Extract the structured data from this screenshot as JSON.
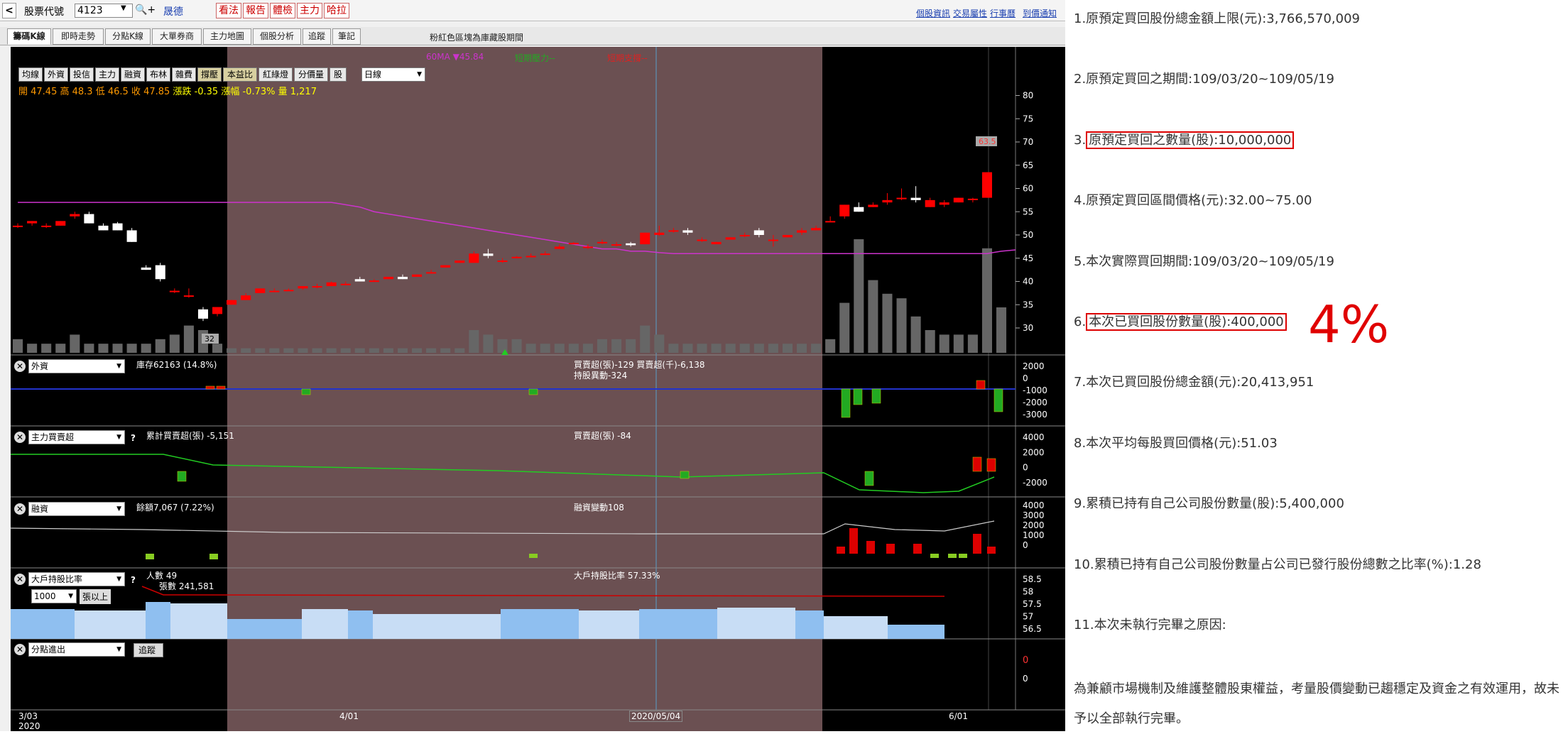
{
  "toolbar": {
    "back": "<",
    "stock_label": "股票代號",
    "stock_code": "4123",
    "search_plus": "🔍+",
    "company": "晟德",
    "buttons": [
      "看法",
      "報告",
      "體檢",
      "主力",
      "哈拉"
    ],
    "links": [
      "個股資訊",
      "交易屬性",
      "行事曆",
      "到價通知"
    ]
  },
  "tabs": [
    "籌碼K線",
    "即時走勢",
    "分點K線",
    "大單券商",
    "主力地圖",
    "個股分析",
    "追蹤",
    "筆記"
  ],
  "note": "粉紅色區塊為庫藏股期間",
  "legend": {
    "ma": "60MA ▼45.84",
    "short_power": "短期壓力--",
    "short_support": "短期支撐--"
  },
  "indicator_buttons": [
    "均線",
    "外資",
    "投信",
    "主力",
    "融資",
    "布林",
    "雜費",
    "撐壓",
    "本益比",
    "紅綠燈",
    "分價量",
    "股"
  ],
  "period": "日線",
  "ohlc": {
    "open": "開 47.45",
    "high": "高 48.3",
    "low": "低 46.5",
    "close": "收 47.85",
    "change": "漲跌 -0.35",
    "pct": "漲幅 -0.73%",
    "vol": "量 1,217"
  },
  "price_axis": [
    "80",
    "75",
    "70",
    "65",
    "60",
    "55",
    "50",
    "45",
    "40",
    "35",
    "30"
  ],
  "markers": {
    "low": "32",
    "high": "63.5"
  },
  "panels": {
    "foreign": {
      "select": "外資",
      "inventory": "庫存62163 (14.8%)",
      "buysell": "買賣超(張)-129 買賣超(千)-6,138",
      "change": "持股異動-324",
      "axis": [
        "2000",
        "0",
        "-1000",
        "-2000",
        "-3000"
      ]
    },
    "main": {
      "select": "主力買賣超",
      "q": "?",
      "cum": "累計買賣超(張) -5,151",
      "buysell": "買賣超(張) -84",
      "axis": [
        "4000",
        "2000",
        "0",
        "-2000"
      ]
    },
    "margin": {
      "select": "融資",
      "balance": "餘額7,067 (7.22%)",
      "change": "融資變動108",
      "axis": [
        "4000",
        "3000",
        "2000",
        "1000",
        "0"
      ]
    },
    "holders": {
      "select": "大戶持股比率",
      "q": "?",
      "people": "人數 49",
      "shares": "張數 241,581",
      "sub_select": "1000",
      "sub_label": "張以上",
      "ratio": "大戶持股比率 57.33%",
      "axis": [
        "58.5",
        "58",
        "57.5",
        "57",
        "56.5"
      ]
    },
    "branch": {
      "select": "分點進出",
      "track": "追蹤",
      "axis": [
        "0",
        "0"
      ]
    }
  },
  "dates": {
    "d1": "3/03",
    "y1": "2020",
    "d2": "4/01",
    "cursor": "2020/05/04",
    "d3": "6/01"
  },
  "chart_data": {
    "type": "candlestick",
    "candles": [
      [
        52,
        52.5,
        51.5,
        52
      ],
      [
        52.5,
        53,
        52,
        53
      ],
      [
        52,
        52.5,
        51.5,
        52
      ],
      [
        52,
        53,
        52,
        53
      ],
      [
        54,
        55,
        53.5,
        54.5
      ],
      [
        54.5,
        55,
        52.5,
        52.5
      ],
      [
        52,
        52.5,
        51,
        51
      ],
      [
        52.5,
        52.8,
        51,
        51
      ],
      [
        51,
        51.5,
        48.5,
        48.5
      ],
      [
        43,
        43.5,
        42.5,
        42.5
      ],
      [
        43.5,
        44,
        40,
        40.5
      ],
      [
        38,
        38.5,
        37.5,
        38
      ],
      [
        37,
        38.5,
        36.5,
        37
      ],
      [
        34,
        34.5,
        31.5,
        32
      ],
      [
        33,
        34.5,
        32.5,
        34.5
      ],
      [
        35,
        36,
        35,
        36
      ],
      [
        36,
        37.5,
        36,
        37
      ],
      [
        37.5,
        38.5,
        37.5,
        38.5
      ],
      [
        38,
        38.5,
        38,
        38
      ],
      [
        38,
        38.5,
        38,
        38.2
      ],
      [
        38.5,
        39,
        38.2,
        39
      ],
      [
        39,
        39.5,
        38.5,
        39
      ],
      [
        39,
        40,
        39,
        39.8
      ],
      [
        39.5,
        40,
        39.5,
        39.5
      ],
      [
        40.5,
        41,
        40,
        40
      ],
      [
        40,
        40.5,
        40,
        40.2
      ],
      [
        40.5,
        41,
        40.5,
        41
      ],
      [
        41,
        41.5,
        40.5,
        40.5
      ],
      [
        41,
        41.5,
        41,
        41.5
      ],
      [
        42,
        42.5,
        42,
        42
      ],
      [
        43,
        43.5,
        43,
        43.5
      ],
      [
        44,
        44.5,
        44,
        44.5
      ],
      [
        44,
        46.5,
        44,
        46
      ],
      [
        46,
        47,
        45,
        45.5
      ],
      [
        44.5,
        45,
        44,
        44.5
      ],
      [
        45,
        45.5,
        45,
        45.3
      ],
      [
        45.5,
        46,
        45.5,
        45.5
      ],
      [
        46,
        46.5,
        46,
        46
      ],
      [
        47,
        48,
        47,
        47.5
      ],
      [
        48,
        48.5,
        48,
        48.3
      ],
      [
        47.5,
        48,
        47,
        47.5
      ],
      [
        48.5,
        49,
        48,
        48.5
      ],
      [
        48,
        48.5,
        47.5,
        48
      ],
      [
        48.2,
        48.5,
        47.5,
        47.8
      ],
      [
        48,
        50.5,
        48,
        50.5
      ],
      [
        50,
        52,
        49.8,
        50.5
      ],
      [
        51,
        51.5,
        50.5,
        51
      ],
      [
        51,
        51.5,
        50,
        50.5
      ],
      [
        49,
        49.5,
        48.5,
        49
      ],
      [
        48,
        48.5,
        48,
        48.5
      ],
      [
        49,
        49.5,
        49,
        49.5
      ],
      [
        50,
        50.5,
        49.5,
        50
      ],
      [
        51,
        51.5,
        49.5,
        50
      ],
      [
        49,
        50,
        47.5,
        49
      ],
      [
        49.5,
        50,
        49.5,
        50
      ],
      [
        50.5,
        51.5,
        50,
        51
      ],
      [
        51,
        52,
        51,
        51.5
      ],
      [
        53,
        54,
        53,
        53
      ],
      [
        54,
        56.5,
        53.5,
        56.5
      ],
      [
        56,
        57,
        55,
        55
      ],
      [
        56,
        57,
        56,
        56.5
      ],
      [
        57,
        59,
        56.5,
        57.5
      ],
      [
        58,
        60,
        57.5,
        58
      ],
      [
        58,
        60.5,
        57,
        57.5
      ],
      [
        56,
        58,
        56,
        57.5
      ],
      [
        56.5,
        57.5,
        56,
        57
      ],
      [
        57,
        58,
        57,
        58
      ],
      [
        57.5,
        58,
        57,
        57.8
      ],
      [
        58,
        63.5,
        58,
        63.5
      ]
    ],
    "volume": [
      3,
      2,
      2,
      2,
      4,
      2,
      2,
      2,
      2,
      2,
      3,
      4,
      6,
      5,
      2,
      1,
      1,
      1,
      1,
      1,
      1,
      1,
      1,
      1,
      1,
      1,
      1,
      1,
      1,
      1,
      1,
      1,
      5,
      4,
      3,
      3,
      2,
      2,
      2,
      2,
      2,
      3,
      3,
      3,
      6,
      4,
      2,
      2,
      2,
      2,
      2,
      2,
      2,
      2,
      2,
      2,
      2,
      3,
      11,
      25,
      16,
      13,
      12,
      8,
      5,
      4,
      4,
      4,
      23,
      10
    ],
    "ma60": [
      57,
      57,
      57,
      57,
      57,
      57,
      57,
      57,
      57,
      57,
      57,
      57,
      57,
      57,
      57,
      57,
      57,
      57,
      57,
      57,
      57,
      57,
      57,
      56.5,
      56,
      55,
      54.5,
      54,
      53.5,
      53,
      52.5,
      52,
      51.5,
      51,
      50.5,
      50,
      49.5,
      49,
      48.5,
      48,
      47.5,
      47,
      47,
      46.5,
      46.5,
      46.2,
      46,
      46,
      46,
      46,
      46,
      46,
      46,
      46,
      46,
      46,
      46,
      46,
      46,
      46,
      46,
      46,
      46,
      46,
      46,
      46,
      46,
      46,
      46,
      46.5,
      46.8
    ]
  }
}
